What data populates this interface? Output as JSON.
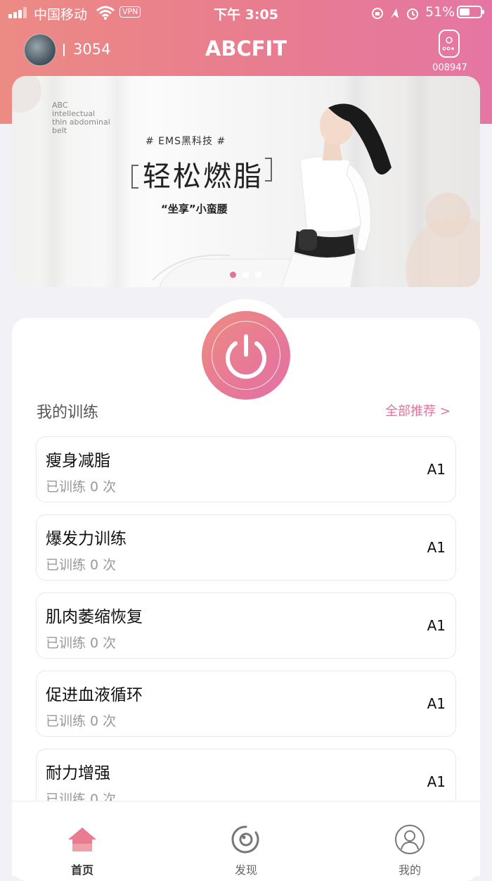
{
  "status_bar": {
    "carrier": "中国移动",
    "vpn": "VPN",
    "time": "下午 3:05",
    "battery": "51%"
  },
  "header": {
    "score": "3054",
    "title": "ABCFIT",
    "device_code": "008947"
  },
  "banner": {
    "small_text": [
      "ABC",
      "intellectual",
      "thin abdominal",
      "belt"
    ],
    "tag": "# EMS黑科技 #",
    "title": "轻松燃脂",
    "subtitle": "“坐享”小蛮腰",
    "active_dot": 0,
    "dot_count": 3
  },
  "training": {
    "title": "我的训练",
    "all_link": "全部推荐 >",
    "items": [
      {
        "name": "瘦身减脂",
        "count": "已训练 0 次",
        "level": "A1"
      },
      {
        "name": "爆发力训练",
        "count": "已训练 0 次",
        "level": "A1"
      },
      {
        "name": "肌肉萎缩恢复",
        "count": "已训练 0 次",
        "level": "A1"
      },
      {
        "name": "促进血液循环",
        "count": "已训练 0 次",
        "level": "A1"
      },
      {
        "name": "耐力增强",
        "count": "已训练 0 次",
        "level": "A1"
      }
    ]
  },
  "tabbar": {
    "home": "首页",
    "discover": "发现",
    "mine": "我的"
  },
  "colors": {
    "accent": "#e2739b",
    "header_start": "#ec8a84",
    "header_end": "#e576a3"
  }
}
